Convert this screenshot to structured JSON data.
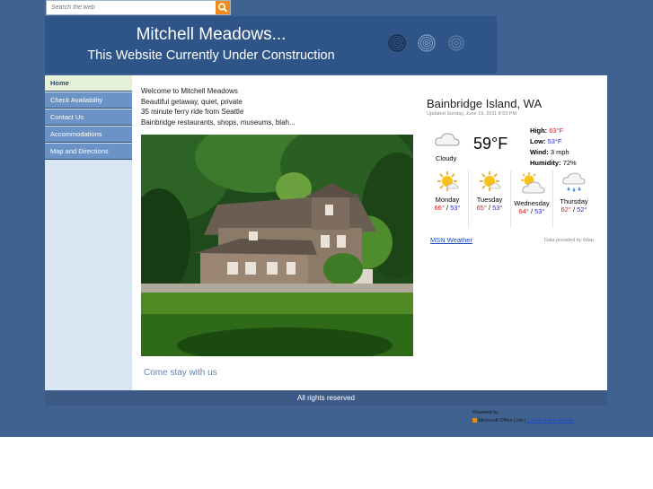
{
  "search": {
    "placeholder": "Search the web"
  },
  "site": {
    "title": "Mitchell Meadows...",
    "subtitle": "This Website Currently Under Construction"
  },
  "nav": [
    {
      "label": "Home",
      "active": true
    },
    {
      "label": "Check Availability"
    },
    {
      "label": "Contact Us"
    },
    {
      "label": "Accommodations"
    },
    {
      "label": "Map and Directions"
    }
  ],
  "intro": [
    "Welcome to Mitchell Meadows",
    "Beautiful getaway, quiet, private",
    "35 minute ferry ride from Seattle",
    "Bainbridge restaurants, shops, museums, blah..."
  ],
  "stay_text": "Come stay with us",
  "weather": {
    "city": "Bainbridge Island, WA",
    "updated": "Updated Sunday, June 19, 2011 8:53 PM",
    "current": {
      "condition": "Cloudy",
      "temp": "59°F",
      "icon": "cloudy-icon"
    },
    "details": {
      "high_label": "High:",
      "high": "63°F",
      "low_label": "Low:",
      "low": "53°F",
      "wind_label": "Wind:",
      "wind": "3 mph",
      "humidity_label": "Humidity:",
      "humidity": "72%"
    },
    "forecast": [
      {
        "day": "Monday",
        "hi": "66°",
        "lo": "53°",
        "icon": "sunny-icon"
      },
      {
        "day": "Tuesday",
        "hi": "65°",
        "lo": "53°",
        "icon": "sunny-icon"
      },
      {
        "day": "Wednesday",
        "hi": "64°",
        "lo": "53°",
        "icon": "partly-cloudy-icon"
      },
      {
        "day": "Thursday",
        "hi": "62°",
        "lo": "52°",
        "icon": "rain-icon"
      }
    ],
    "link": "MSN Weather",
    "provider": "Data provided by iMap"
  },
  "footer": {
    "text": "All rights reserved"
  },
  "powered": {
    "label": "Powered by",
    "product": "Microsoft Office Live",
    "sep": "|",
    "link": "Create a free website"
  },
  "colors": {
    "background": "#3f6290",
    "banner": "#2f5487",
    "nav_item": "#6b93c5",
    "nav_active": "#e5f2d9",
    "sidebar": "#dae6f4",
    "search_button": "#f08a1c"
  }
}
